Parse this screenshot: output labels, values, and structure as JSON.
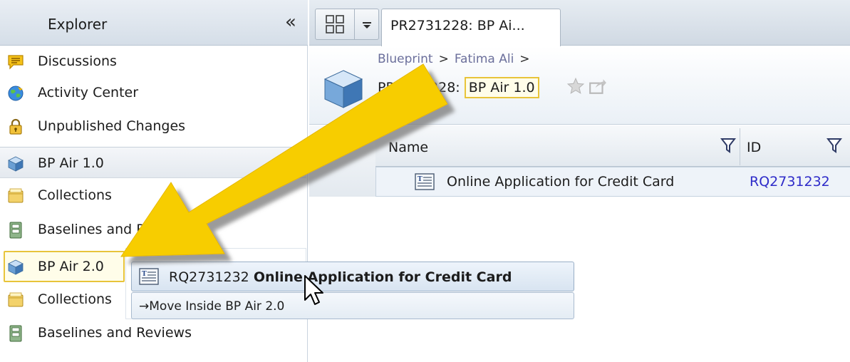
{
  "sidebar": {
    "title": "Explorer",
    "collapse_symbol": "«",
    "items": [
      {
        "label": "Discussions",
        "icon": "discussion-icon"
      },
      {
        "label": "Activity Center",
        "icon": "activity-globe-icon"
      },
      {
        "label": "Unpublished Changes",
        "icon": "lock-icon"
      },
      {
        "label": "BP Air 1.0",
        "icon": "project-cube-icon"
      },
      {
        "label": "Collections",
        "icon": "collections-folder-icon"
      },
      {
        "label": "Baselines and Reviews",
        "icon": "baseline-icon"
      },
      {
        "label": "BP Air 2.0",
        "icon": "project-cube-icon"
      },
      {
        "label": "Collections",
        "icon": "collections-folder-icon"
      },
      {
        "label": "Baselines and Reviews",
        "icon": "baseline-icon"
      }
    ]
  },
  "tabs": {
    "active_label": "PR2731228: BP Ai..."
  },
  "header": {
    "breadcrumb": [
      "Blueprint",
      "Fatima Ali"
    ],
    "breadcrumb_sep": ">",
    "title_prefix": "PR2731228:",
    "title_name": "BP Air 1.0"
  },
  "grid": {
    "columns": [
      "Name",
      "ID"
    ],
    "rows": [
      {
        "name": "Online Application for Credit Card",
        "id": "RQ2731232"
      }
    ]
  },
  "drag": {
    "item_id": "RQ2731232",
    "item_name": "Online Application for Credit Card",
    "action_arrow": "→",
    "action_label": "Move Inside BP Air 2.0"
  },
  "colors": {
    "highlight": "#e8c43a",
    "arrow": "#f7cd00",
    "link": "#2e2bc9",
    "breadcrumb": "#6b6f9b"
  }
}
